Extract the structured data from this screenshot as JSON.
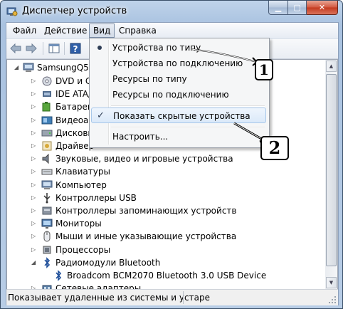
{
  "window": {
    "title": "Диспетчер устройств",
    "minimize_icon": "minimize-icon",
    "maximize_icon": "maximize-icon",
    "close_icon": "close-icon"
  },
  "menubar": {
    "items": [
      "Файл",
      "Действие",
      "Вид",
      "Справка"
    ],
    "active": "Вид"
  },
  "tree": {
    "root": "SamsungQ53",
    "items": [
      {
        "label": "DVD и CD",
        "icon": "dvd-drive-icon"
      },
      {
        "label": "IDE ATA/A",
        "icon": "ide-controller-icon"
      },
      {
        "label": "Батареи",
        "icon": "battery-icon"
      },
      {
        "label": "Видеоада",
        "icon": "display-adapter-icon"
      },
      {
        "label": "Дисковы",
        "icon": "disk-drive-icon"
      },
      {
        "label": "Драйвер",
        "icon": "driver-icon"
      },
      {
        "label": "Звуковые, видео и игровые устройства",
        "icon": "speaker-icon"
      },
      {
        "label": "Клавиатуры",
        "icon": "keyboard-icon"
      },
      {
        "label": "Компьютер",
        "icon": "computer-icon"
      },
      {
        "label": "Контроллеры USB",
        "icon": "usb-icon"
      },
      {
        "label": "Контроллеры запоминающих устройств",
        "icon": "storage-controller-icon"
      },
      {
        "label": "Мониторы",
        "icon": "monitor-icon"
      },
      {
        "label": "Мыши и иные указывающие устройства",
        "icon": "mouse-icon"
      },
      {
        "label": "Процессоры",
        "icon": "processor-icon"
      },
      {
        "label": "Радиомодули Bluetooth",
        "icon": "bluetooth-icon"
      },
      {
        "label": "Broadcom BCM2070 Bluetooth 3.0 USB Device",
        "icon": "bluetooth-icon"
      },
      {
        "label": "Сетевые адаптеры",
        "icon": "network-adapter-icon"
      }
    ]
  },
  "view_menu": {
    "items": [
      {
        "label": "Устройства по типу",
        "mark": "radio"
      },
      {
        "label": "Устройства по подключению",
        "mark": ""
      },
      {
        "label": "Ресурсы по типу",
        "mark": ""
      },
      {
        "label": "Ресурсы по подключению",
        "mark": ""
      },
      {
        "label": "Показать скрытые устройства",
        "mark": "check"
      },
      {
        "label": "Настроить...",
        "mark": ""
      }
    ],
    "highlighted": "Показать скрытые устройства"
  },
  "status": {
    "text": "Показывает удаленные из системы и устаре"
  },
  "callouts": [
    "1",
    "2"
  ]
}
